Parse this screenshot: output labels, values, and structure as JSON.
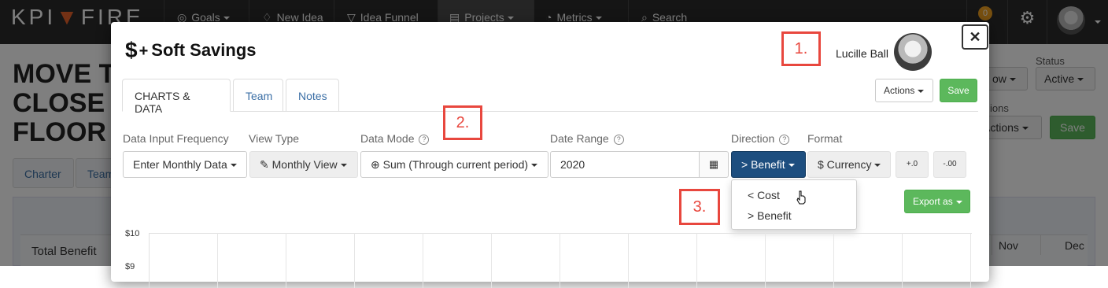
{
  "navbar": {
    "logo_left": "KPI",
    "logo_mid": "▼",
    "logo_right": "FIRE",
    "items": [
      {
        "label": "Goals",
        "icon": "compass-icon"
      },
      {
        "label": "New Idea",
        "icon": "lightbulb-icon"
      },
      {
        "label": "Idea Funnel",
        "icon": "funnel-icon"
      },
      {
        "label": "Projects",
        "icon": "projects-icon"
      },
      {
        "label": "Metrics",
        "icon": "gauge-icon"
      },
      {
        "label": "Search",
        "icon": "search-icon"
      }
    ],
    "notification_count": "0"
  },
  "background_page": {
    "title_lines": [
      "MOVE T",
      "CLOSE",
      "FLOOR"
    ],
    "status_label": "Status",
    "status_value": "Active",
    "partial_button": "ow",
    "actions_label": "Actions",
    "actions_partial_label": "ions",
    "save_label": "Save",
    "tabs": [
      "Charter",
      "Team"
    ],
    "total_benefit_label": "Total Benefit",
    "month_headers": [
      "Nov",
      "Dec"
    ]
  },
  "modal": {
    "title_symbol": "$",
    "title_plus": "+",
    "title": "Soft Savings",
    "owner_name": "Lucille Ball",
    "actions_label": "Actions",
    "save_label": "Save",
    "tabs": [
      {
        "label": "CHARTS & DATA",
        "active": true
      },
      {
        "label": "Team",
        "active": false
      },
      {
        "label": "Notes",
        "active": false
      }
    ],
    "controls": {
      "input_freq_label": "Data Input Frequency",
      "input_freq_value": "Enter Monthly Data",
      "view_type_label": "View Type",
      "view_type_value": "Monthly View",
      "data_mode_label": "Data Mode",
      "data_mode_value": "Sum (Through current period)",
      "date_range_label": "Date Range",
      "date_range_value": "2020",
      "direction_label": "Direction",
      "direction_value": "> Benefit",
      "format_label": "Format",
      "format_value": "$ Currency",
      "increase_decimals": "+.0",
      "decrease_decimals": "-.00"
    },
    "direction_options": [
      "< Cost",
      "> Benefit"
    ],
    "export_label": "Export as",
    "chart": {
      "y_ticks": [
        "$10",
        "$9"
      ]
    }
  },
  "callouts": [
    "1.",
    "2.",
    "3."
  ],
  "colors": {
    "navbar_bg": "#2b2b2b",
    "accent_orange": "#e8632b",
    "save_green": "#5cb85c",
    "direction_navy": "#1d4e7f",
    "callout_red": "#e8473e",
    "link_blue": "#3a6ea5"
  }
}
